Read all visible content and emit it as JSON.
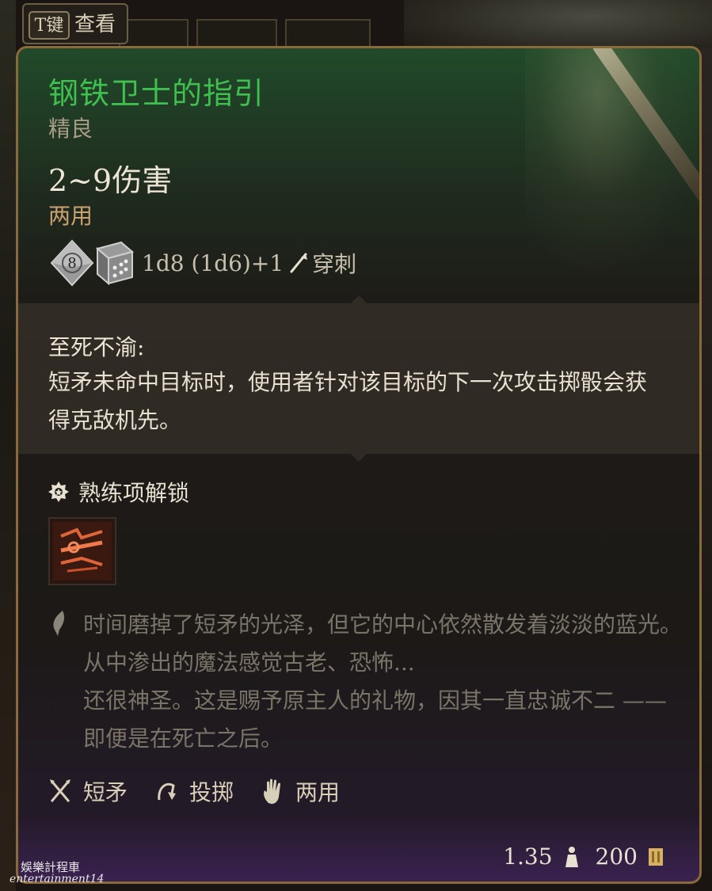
{
  "topbar": {
    "key_label": "T键",
    "action_label": "查看"
  },
  "item": {
    "name": "钢铁卫士的指引",
    "rarity": "精良",
    "damage": "2~9伤害",
    "handedness": "两用",
    "dice": {
      "die1_face": "8",
      "formula": "1d8 (1d6)+1",
      "damage_type": "穿刺"
    },
    "passive": {
      "name": "至死不渝:",
      "description": "短矛未命中目标时，使用者针对该目标的下一次攻击掷骰会获得克敌机先。"
    },
    "proficiency": {
      "label": "熟练项解锁"
    },
    "lore": "时间磨掉了短矛的光泽，但它的中心依然散发着淡淡的蓝光。从中渗出的魔法感觉古老、恐怖...\n还很神圣。这是赐予原主人的礼物，因其一直忠诚不二 —— 即便是在死亡之后。",
    "tags": [
      {
        "icon": "crossed-spears-icon",
        "label": "短矛"
      },
      {
        "icon": "throw-arc-icon",
        "label": "投掷"
      },
      {
        "icon": "hand-icon",
        "label": "两用"
      }
    ],
    "weight": "1.35",
    "price": "200"
  },
  "watermark": {
    "line1": "娛樂計程車",
    "line2": "entertainment14"
  },
  "colors": {
    "title_green": "#3fbf4f",
    "handedness_orange": "#c8a270",
    "border_gold": "#8a6a3a",
    "lore_grey": "#7a7468"
  }
}
